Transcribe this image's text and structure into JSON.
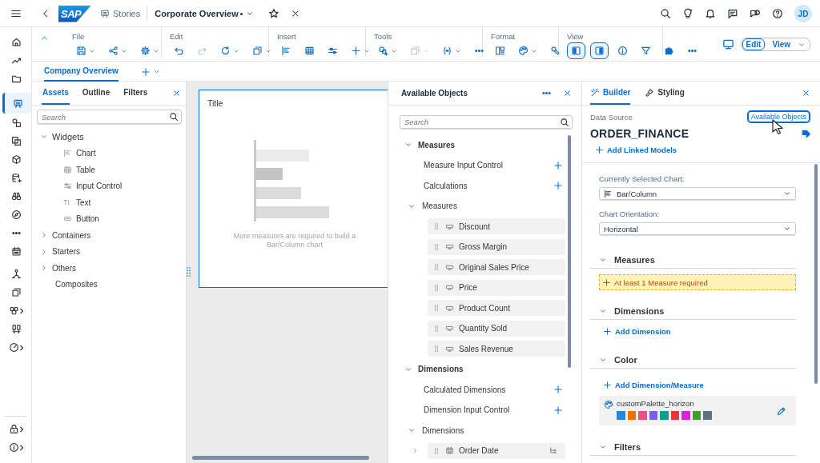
{
  "shell": {
    "logo": "SAP",
    "app": "Stories",
    "document_title": "Corporate Overview",
    "unsaved": true,
    "avatar": "JD"
  },
  "side_nav": {
    "items": [
      {
        "selected": false
      },
      {
        "selected": false
      },
      {
        "selected": false
      },
      {
        "selected": true
      },
      {
        "selected": false
      },
      {
        "selected": false
      },
      {
        "selected": false
      },
      {
        "selected": false
      },
      {
        "selected": false
      },
      {
        "selected": false
      },
      {
        "selected": false
      },
      {
        "selected": false
      },
      {
        "selected": false
      },
      {
        "selected": false
      },
      {
        "selected": false
      },
      {
        "selected": false
      },
      {
        "selected": false
      }
    ],
    "bottom_items": [
      {
        "selected": false
      },
      {
        "selected": false
      }
    ]
  },
  "toolbar": {
    "groups": [
      {
        "label": "File",
        "tools": [
          {
            "menu": true,
            "disabled": false
          },
          {
            "menu": true,
            "disabled": false
          },
          {
            "menu": true,
            "disabled": false
          }
        ]
      },
      {
        "label": "Edit",
        "tools": [
          {
            "menu": false,
            "disabled": false
          },
          {
            "menu": false,
            "disabled": true
          },
          {
            "menu": true,
            "disabled": false
          },
          {
            "menu": true,
            "disabled": false
          }
        ]
      },
      {
        "label": "Insert",
        "tools": [
          {
            "menu": false,
            "disabled": false
          },
          {
            "menu": false,
            "disabled": false
          },
          {
            "menu": false,
            "disabled": false
          },
          {
            "menu": true,
            "disabled": false
          }
        ]
      },
      {
        "label": "Tools",
        "tools": [
          {
            "menu": true,
            "disabled": false
          },
          {
            "menu": true,
            "disabled": true
          },
          {
            "menu": true,
            "disabled": false
          },
          {
            "menu": false,
            "disabled": false
          }
        ]
      },
      {
        "label": "Format",
        "tools": [
          {
            "menu": false,
            "disabled": false
          },
          {
            "menu": true,
            "disabled": false
          },
          {
            "menu": false,
            "disabled": false
          }
        ]
      },
      {
        "label": "View",
        "tools": [
          {
            "menu": false,
            "disabled": false,
            "pressed": true
          },
          {
            "menu": false,
            "disabled": false,
            "pressed": true
          },
          {
            "menu": false,
            "disabled": false,
            "pressed": false
          },
          {
            "menu": false,
            "disabled": false,
            "pressed": false
          },
          {
            "menu": false,
            "disabled": false,
            "pressed": false
          },
          {
            "menu": false,
            "disabled": false,
            "pressed": false
          }
        ]
      }
    ],
    "mode_switch": [
      {
        "label": "Edit",
        "selected": true
      },
      {
        "label": "View",
        "selected": false
      }
    ]
  },
  "page_tabs": [
    {
      "label": "Company Overview",
      "selected": true
    }
  ],
  "assets_panel": {
    "tabs": [
      {
        "label": "Assets",
        "selected": true
      },
      {
        "label": "Outline",
        "selected": false
      },
      {
        "label": "Filters",
        "selected": false
      }
    ],
    "search": {
      "placeholder": "Search"
    },
    "tree": [
      {
        "label": "Widgets",
        "kind": "group",
        "expanded": true,
        "children": [
          {
            "label": "Chart"
          },
          {
            "label": "Table"
          },
          {
            "label": "Input Control"
          },
          {
            "glyph": "Tt",
            "label": "Text"
          },
          {
            "label": "Button"
          }
        ]
      },
      {
        "label": "Containers",
        "kind": "group",
        "expanded": false
      },
      {
        "label": "Starters",
        "kind": "group",
        "expanded": false
      },
      {
        "label": "Others",
        "kind": "group",
        "expanded": false
      },
      {
        "label": "Composites",
        "kind": "leaf",
        "expanded": false
      }
    ]
  },
  "canvas": {
    "widget": {
      "title": "Title",
      "message": "More measures are required to build a Bar/Column chart",
      "selected": true
    }
  },
  "objects_panel": {
    "title": "Available Objects",
    "search": {
      "placeholder": "Search"
    },
    "sections": [
      {
        "label": "Measures",
        "expanded": true,
        "actions": [
          {
            "label": "Measure Input Control"
          },
          {
            "label": "Calculations"
          }
        ],
        "group": {
          "label": "Measures",
          "expanded": true,
          "items": [
            {
              "label": "Discount"
            },
            {
              "label": "Gross Margin"
            },
            {
              "label": "Original Sales Price"
            },
            {
              "label": "Price"
            },
            {
              "label": "Product Count"
            },
            {
              "label": "Quantity Sold"
            },
            {
              "label": "Sales Revenue"
            }
          ]
        }
      },
      {
        "label": "Dimensions",
        "expanded": true,
        "actions": [
          {
            "label": "Calculated Dimensions"
          },
          {
            "label": "Dimension Input Control"
          }
        ],
        "group": {
          "label": "Dimensions",
          "expanded": true,
          "items": [
            {
              "label": "Order Date",
              "expanded": false,
              "hierarchy": true
            }
          ]
        }
      }
    ]
  },
  "builder": {
    "tabs": [
      {
        "label": "Builder",
        "selected": true
      },
      {
        "label": "Styling",
        "selected": false
      }
    ],
    "data_source_label": "Data Source",
    "available_objects_button": {
      "label": "Available Objects",
      "focused": true
    },
    "data_source": "ORDER_FINANCE",
    "add_linked_models": "Add Linked Models",
    "fields": [
      {
        "label": "Currently Selected Chart:",
        "value": "Bar/Column"
      },
      {
        "label": "Chart Orientation:",
        "value": "Horizontal"
      }
    ],
    "sections": [
      {
        "title": "Measures",
        "expanded": true,
        "kind": "warning",
        "text": "At least 1 Measure required"
      },
      {
        "title": "Dimensions",
        "expanded": true,
        "kind": "add",
        "text": "Add Dimension"
      },
      {
        "title": "Color",
        "expanded": true,
        "kind": "add",
        "text": "Add Dimension/Measure",
        "palette": {
          "name": "customPalette_horizon",
          "colors": [
            {
              "color": "#1e88e5"
            },
            {
              "color": "#e8710a"
            },
            {
              "color": "#e8508a"
            },
            {
              "color": "#7b5cf0"
            },
            {
              "color": "#159a8c"
            },
            {
              "color": "#e53935"
            },
            {
              "color": "#e020e0"
            },
            {
              "color": "#3f9e2f"
            },
            {
              "color": "#5f7282"
            }
          ]
        }
      },
      {
        "title": "Filters",
        "expanded": true,
        "kind": "empty"
      }
    ]
  }
}
